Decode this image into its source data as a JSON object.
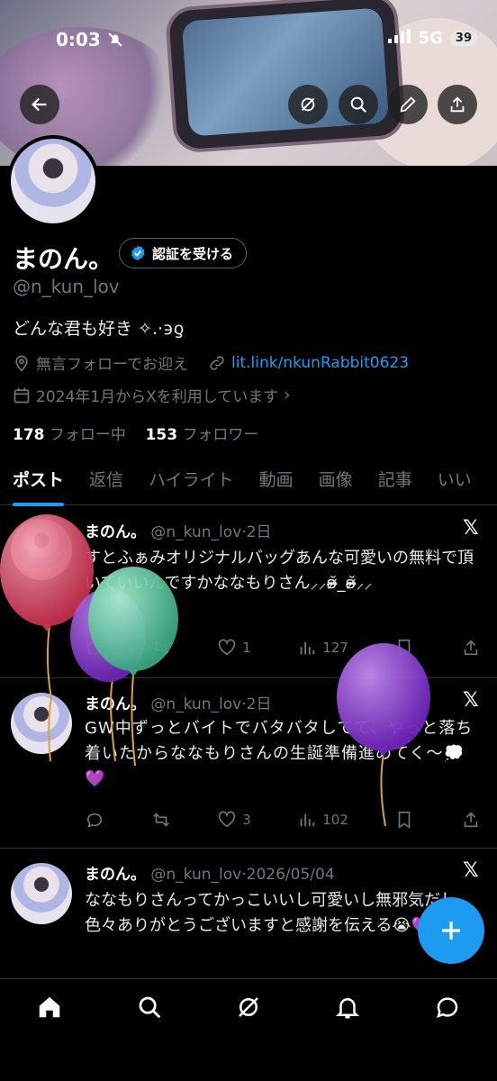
{
  "status_bar": {
    "time": "0:03",
    "network": "5G",
    "battery": "39"
  },
  "profile": {
    "display_name": "まのん。",
    "verify_label": "認証を受ける",
    "handle": "@n_kun_lov",
    "bio": "どんな君も好き ✧.·϶ƍ",
    "location": "無言フォローでお迎え",
    "link": "lit.link/nkunRabbit0623",
    "joined": "2024年1月からXを利用しています",
    "following_count": "178",
    "following_label": "フォロー中",
    "followers_count": "153",
    "followers_label": "フォロワー"
  },
  "tabs": [
    {
      "label": "ポスト",
      "active": true
    },
    {
      "label": "返信"
    },
    {
      "label": "ハイライト"
    },
    {
      "label": "動画"
    },
    {
      "label": "画像"
    },
    {
      "label": "記事"
    },
    {
      "label": "いい"
    }
  ],
  "posts": [
    {
      "name": "まのん。",
      "handle": "@n_kun_lov",
      "date": "2日",
      "text": "すとふぁみオリジナルバッグあんな可愛いの無料で頂いていいんですかななもりさん⸝⸝ʚ̴̶̷̆_ʚ̴̶̷̆⸝⸝",
      "replies": "",
      "reposts": "",
      "likes": "1",
      "views": "127"
    },
    {
      "name": "まのん。",
      "handle": "@n_kun_lov",
      "date": "2日",
      "text": "GW中ずっとバイトでバタバタしてて、やっと落ち着いたからななもりさんの生誕準備進めてく〜💭💜",
      "replies": "",
      "reposts": "",
      "likes": "3",
      "views": "102"
    },
    {
      "name": "まのん。",
      "handle": "@n_kun_lov",
      "date": "2026/05/04",
      "text": "ななもりさんってかっこいいし可愛いし無邪気だし色々ありがとうございますと感謝を伝える😭💜"
    }
  ],
  "colors": {
    "accent": "#1d9bf0",
    "balloon_red": "#e0506a",
    "balloon_purple": "#8a38d4",
    "balloon_green": "#58c9a0"
  }
}
